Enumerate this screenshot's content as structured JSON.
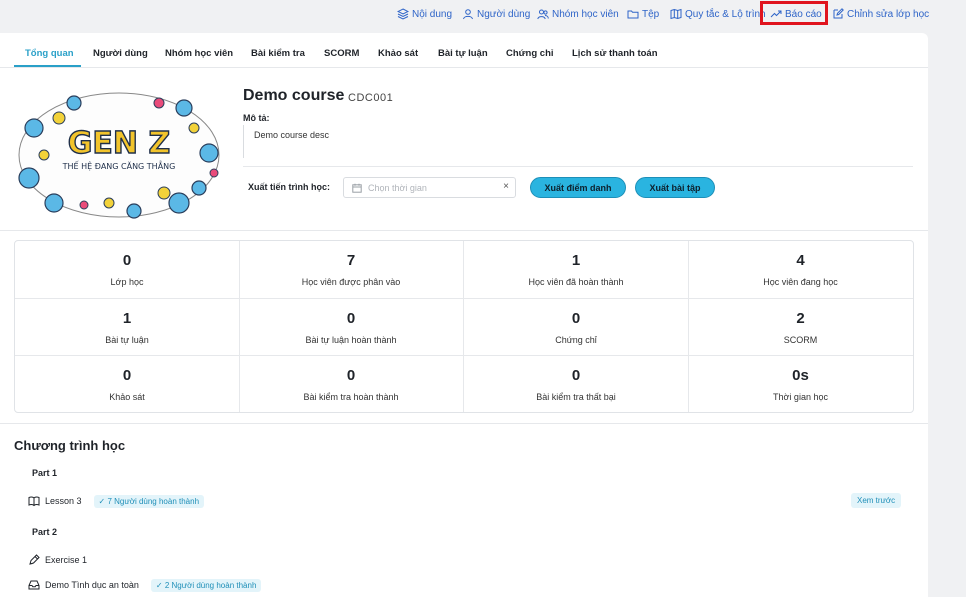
{
  "toolbar": {
    "items": [
      {
        "label": "Nội dung",
        "icon": "layers-icon"
      },
      {
        "label": "Người dùng",
        "icon": "user-icon"
      },
      {
        "label": "Nhóm học viên",
        "icon": "users-icon"
      },
      {
        "label": "Tệp",
        "icon": "folder-icon"
      },
      {
        "label": "Quy tắc & Lộ trình",
        "icon": "map-icon"
      },
      {
        "label": "Báo cáo",
        "icon": "trend-icon"
      },
      {
        "label": "Chỉnh sửa lớp học",
        "icon": "edit-icon"
      }
    ]
  },
  "tabs": [
    "Tổng quan",
    "Người dùng",
    "Nhóm học viên",
    "Bài kiểm tra",
    "SCORM",
    "Khảo sát",
    "Bài tự luận",
    "Chứng chỉ",
    "Lịch sử thanh toán"
  ],
  "course": {
    "image_text": {
      "main": "GEN Z",
      "sub": "THẾ HỆ ĐANG CĂNG THẲNG"
    },
    "title": "Demo course",
    "code": "CDC001",
    "desc_label": "Mô tả:",
    "description": "Demo course desc",
    "export_label": "Xuất tiến trình học:",
    "date_placeholder": "Chọn thời gian",
    "clear": "×",
    "btn_attendance": "Xuất điểm danh",
    "btn_exercise": "Xuất bài tập"
  },
  "stats": [
    {
      "value": "0",
      "label": "Lớp học"
    },
    {
      "value": "7",
      "label": "Học viên được phân vào"
    },
    {
      "value": "1",
      "label": "Học viên đã hoàn thành"
    },
    {
      "value": "4",
      "label": "Học viên đang học"
    },
    {
      "value": "1",
      "label": "Bài tự luận"
    },
    {
      "value": "0",
      "label": "Bài tự luận hoàn thành"
    },
    {
      "value": "0",
      "label": "Chứng chỉ"
    },
    {
      "value": "2",
      "label": "SCORM"
    },
    {
      "value": "0",
      "label": "Khảo sát"
    },
    {
      "value": "0",
      "label": "Bài kiểm tra hoàn thành"
    },
    {
      "value": "0",
      "label": "Bài kiểm tra thất bại"
    },
    {
      "value": "0s",
      "label": "Thời gian học"
    }
  ],
  "curriculum": {
    "title": "Chương trình học",
    "part1": "Part 1",
    "lesson3": "Lesson 3",
    "lesson3_badge": "✓ 7 Người dùng hoàn thành",
    "preview": "Xem trước",
    "part2": "Part 2",
    "exercise1": "Exercise 1",
    "demo": "Demo Tình dục an toàn",
    "demo_badge": "✓ 2 Người dùng hoàn thành"
  },
  "colors": {
    "accent": "#2aa0c8",
    "link": "#2e64c8",
    "button": "#2ab4e0",
    "highlight": "#e0141e"
  }
}
